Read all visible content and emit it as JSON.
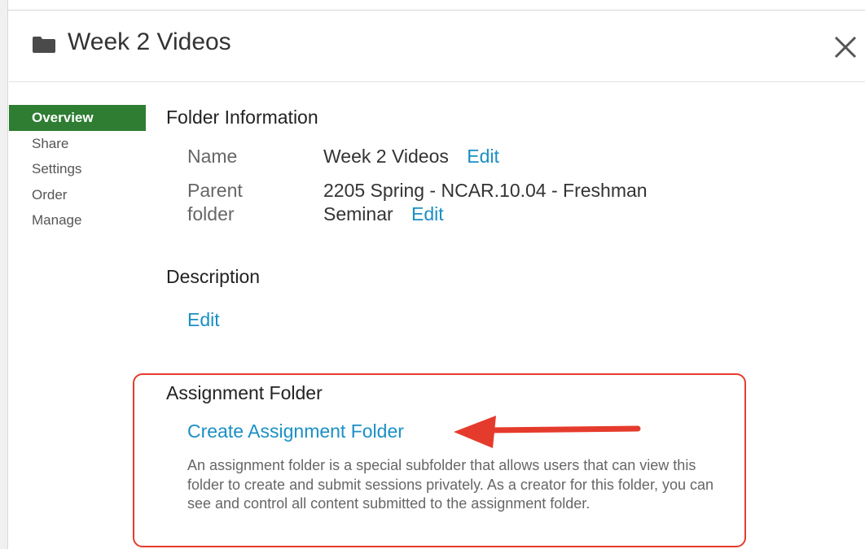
{
  "dialog": {
    "title": "Week 2 Videos",
    "icons": {
      "folder": "folder-icon",
      "close": "close-icon",
      "arrow": "arrow-left-icon"
    }
  },
  "sidebar": {
    "items": [
      {
        "label": "Overview",
        "active": true
      },
      {
        "label": "Share",
        "active": false
      },
      {
        "label": "Settings",
        "active": false
      },
      {
        "label": "Order",
        "active": false
      },
      {
        "label": "Manage",
        "active": false
      }
    ]
  },
  "folder_info": {
    "heading": "Folder Information",
    "name_label": "Name",
    "name_value": "Week 2 Videos",
    "name_edit": "Edit",
    "parent_label_line1": "Parent",
    "parent_label_line2": "folder",
    "parent_value_line1": "2205 Spring - NCAR.10.04 - Freshman",
    "parent_value_line2": "Seminar",
    "parent_edit": "Edit"
  },
  "description": {
    "heading": "Description",
    "edit": "Edit"
  },
  "assignment": {
    "heading": "Assignment Folder",
    "create_link": "Create Assignment Folder",
    "text": "An assignment folder is a special subfolder that allows users that can view this folder to create and submit sessions privately. As a creator for this folder, you can see and control all content submitted to the assignment folder."
  },
  "colors": {
    "accent_green": "#2e7d32",
    "link_blue": "#1a8fc4",
    "highlight_red": "#e53b2c"
  }
}
